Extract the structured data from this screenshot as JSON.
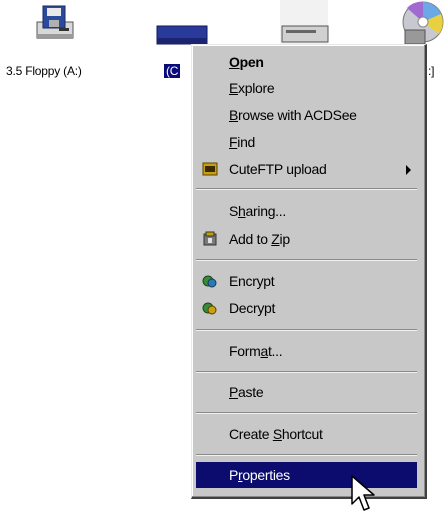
{
  "desktop": {
    "icons": [
      {
        "label": "3.5 Floppy (A:)",
        "icon": "floppy-drive-icon"
      },
      {
        "label": "(C",
        "icon": "hard-drive-icon",
        "selected": true
      },
      {
        "label": "",
        "icon": "cd-drive-icon"
      },
      {
        "label": ":]",
        "icon": "cd-rom-icon"
      }
    ]
  },
  "context_menu": {
    "items": {
      "open": {
        "pre": "",
        "u": "O",
        "post": "pen"
      },
      "explore": {
        "pre": "",
        "u": "E",
        "post": "xplore"
      },
      "browse": {
        "pre": "",
        "u": "B",
        "post": "rowse with ACDSee"
      },
      "find": {
        "pre": "",
        "u": "F",
        "post": "ind"
      },
      "cuteftp": {
        "pre": "CuteFTP upload",
        "u": "",
        "post": ""
      },
      "sharing": {
        "pre": "S",
        "u": "h",
        "post": "aring..."
      },
      "add_to_zip": {
        "pre": "Add to ",
        "u": "Z",
        "post": "ip"
      },
      "encrypt": {
        "pre": "Encrypt",
        "u": "",
        "post": ""
      },
      "decrypt": {
        "pre": "Decrypt",
        "u": "",
        "post": ""
      },
      "format": {
        "pre": "Form",
        "u": "a",
        "post": "t..."
      },
      "paste": {
        "pre": "",
        "u": "P",
        "post": "aste"
      },
      "create_shortcut": {
        "pre": "Create ",
        "u": "S",
        "post": "hortcut"
      },
      "properties": {
        "pre": "P",
        "u": "r",
        "post": "operties"
      }
    },
    "highlighted": "properties",
    "colors": {
      "menu_bg": "#c8c8c8",
      "highlight": "#0c0c6e",
      "selection": "#0a0a7a"
    }
  }
}
